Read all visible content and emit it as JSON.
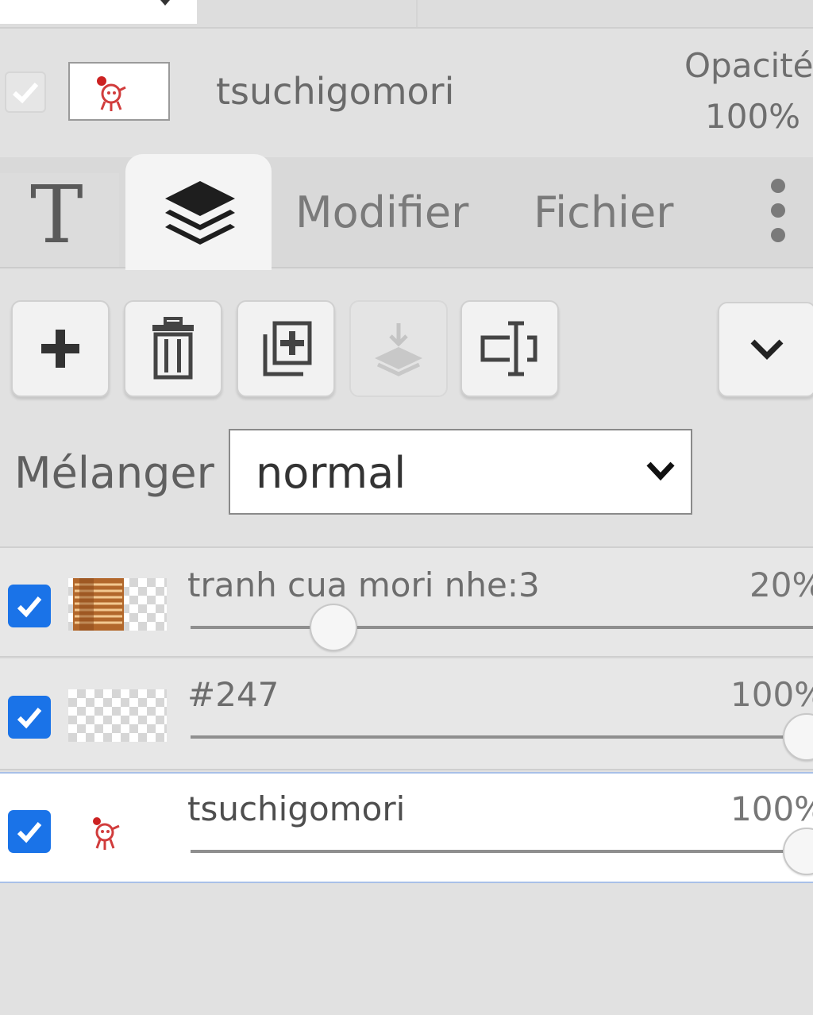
{
  "current_layer": {
    "name": "tsuchigomori",
    "opacity_label": "Opacité",
    "opacity_value": "100%"
  },
  "tabs": {
    "text_tab": "T",
    "modifier": "Modifier",
    "fichier": "Fichier"
  },
  "toolbar": {
    "add_icon": "plus-icon",
    "delete_icon": "trash-icon",
    "duplicate_icon": "duplicate-icon",
    "merge_icon": "merge-down-icon",
    "rename_icon": "rename-icon",
    "collapse_icon": "chevron-down-icon"
  },
  "blend": {
    "label": "Mélanger",
    "value": "normal"
  },
  "layers": [
    {
      "name": "tranh cua mori nhe:3",
      "opacity": "20%",
      "opacity_fraction": 0.2,
      "visible": true,
      "selected": false
    },
    {
      "name": "#247",
      "opacity": "100%",
      "opacity_fraction": 1.0,
      "visible": true,
      "selected": false
    },
    {
      "name": "tsuchigomori",
      "opacity": "100%",
      "opacity_fraction": 1.0,
      "visible": true,
      "selected": true
    }
  ],
  "colors": {
    "accent": "#1a73e8",
    "selection_border": "#a8c0e8",
    "panel_bg": "#e1e1e1"
  }
}
